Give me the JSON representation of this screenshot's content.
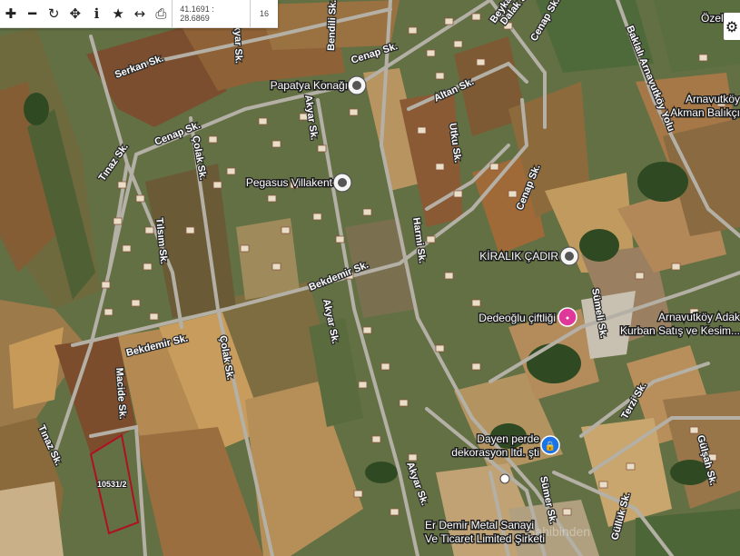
{
  "toolbar": {
    "icons": [
      "plus-icon",
      "minus-icon",
      "refresh-icon",
      "locate-icon",
      "info-icon",
      "star-icon",
      "measure-icon",
      "print-icon"
    ],
    "glyphs": [
      "✚",
      "━",
      "↻",
      "✥",
      "ℹ",
      "★",
      "↔",
      "⎙"
    ],
    "coordinates": "41.1691 : 28.6869",
    "zoom": "16"
  },
  "settings": {
    "glyph": "⚙"
  },
  "parcel": {
    "label": "10531/2",
    "outline_color": "#b01020"
  },
  "roads": [
    "Serkan Sk.",
    "Cenap Sk.",
    "Cenap Sk.",
    "Cenap Sk.",
    "Cenap Sk.",
    "Bendili Sk.",
    "Beykan",
    "Çolak Sk.",
    "Çolak Sk.",
    "Akyar Sk.",
    "Akyar Sk.",
    "Akyar Sk.",
    "Akyar Sk.",
    "Bekdemir Sk.",
    "Bekdemir Sk.",
    "Tınaz Sk.",
    "Tınaz Sk.",
    "Tılsım Sk.",
    "Macide Sk.",
    "Altan Sk.",
    "Utku Sk.",
    "Harmi Sk.",
    "Sümeli Sk.",
    "Terzi Sk.",
    "Sümer Sk.",
    "Güllük Sk.",
    "Gülşah Sk.",
    "Baklalı Arnavutköy Yolu",
    "Dalak Sk."
  ],
  "pois": {
    "papatya": "Papatya Konağı",
    "pegasus": "Pegasus Villakent",
    "kiralik": "KİRALIK ÇADIR",
    "dedeoglu": "Dedeoğlu çiftliği",
    "adak_1": "Arnavutköy Adak",
    "adak_2": "Kurban Satış ve Kesim...",
    "dayen_1": "Dayen perde",
    "dayen_2": "dekorasyon ltd. şti",
    "erdemir_1": "Er Demir Metal Sanayi",
    "erdemir_2": "Ve Ticaret Limited Şirketi",
    "akman_1": "Arnavutköy",
    "akman_2": "Akman Balıkçı",
    "ozel": "Özel"
  },
  "watermark": "Sahibinden",
  "colors": {
    "poi_pin": "#4a4a4a",
    "pink_pin": "#e0389a",
    "blue_pin": "#1a73e8"
  }
}
